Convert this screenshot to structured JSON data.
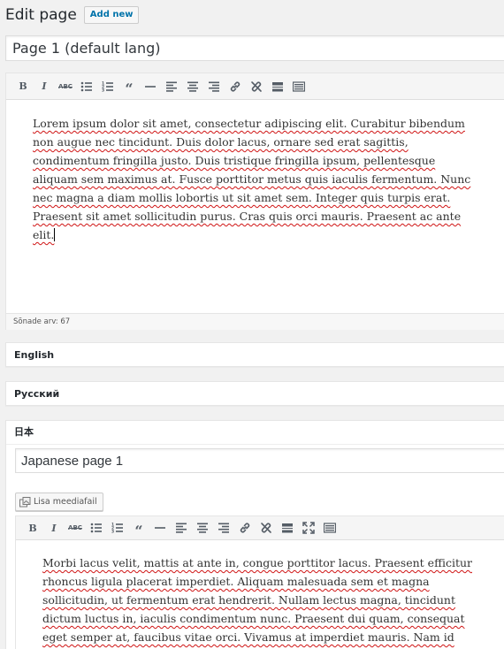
{
  "header": {
    "title": "Edit page",
    "add_new": "Add new"
  },
  "title_input": {
    "value": "Page 1 (default lang)"
  },
  "toolbar1": {
    "buttons": [
      "bold",
      "italic",
      "strikethrough",
      "bullet-list",
      "numbered-list",
      "blockquote",
      "horizontal-rule",
      "align-left",
      "align-center",
      "align-right",
      "link",
      "unlink",
      "read-more",
      "toolbar-toggle"
    ],
    "bold_label": "B",
    "italic_label": "I",
    "strike_label": "ABC",
    "quote_label": "“"
  },
  "editor1": {
    "paragraph": "Lorem ipsum dolor sit amet, consectetur adipiscing elit. Curabitur bibendum non augue nec tincidunt. Duis dolor lacus, ornare sed erat sagittis, condimentum fringilla justo. Duis tristique fringilla ipsum, pellentesque aliquam sem maximus at. Fusce porttitor metus quis iaculis fermentum. Nunc nec magna a diam mollis lobortis ut sit amet sem. Integer quis turpis erat. Praesent sit amet sollicitudin purus. Cras quis orci mauris. Praesent ac ante elit.",
    "word_count": "Sõnade arv: 67"
  },
  "languages": {
    "english": "English",
    "russian": "Русский",
    "japanese": "日本"
  },
  "japanese_section": {
    "title_value": "Japanese page 1",
    "add_media": "Lisa meediafail",
    "paragraph": "Morbi lacus velit, mattis at ante in, congue porttitor lacus. Praesent efficitur rhoncus ligula placerat imperdiet. Aliquam malesuada sem et magna sollicitudin, ut fermentum erat hendrerit. Nullam lectus magna, tincidunt dictum luctus in, iaculis condimentum nunc. Praesent dui quam, consequat eget semper at, faucibus vitae orci. Vivamus at imperdiet mauris. Nam id purus ultrices,"
  },
  "colors": {
    "link_blue": "#0073aa",
    "spellcheck_red": "#d01414",
    "toolbar_bg": "#f5f5f5",
    "page_bg": "#f1f1f1"
  }
}
